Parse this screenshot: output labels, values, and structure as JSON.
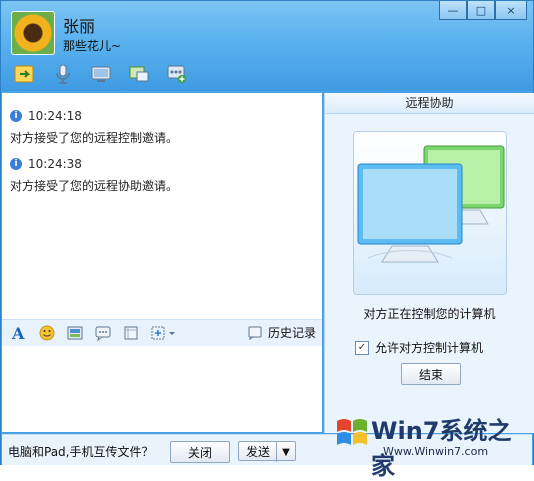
{
  "contact": {
    "name": "张丽",
    "signature": "那些花儿~"
  },
  "window_controls": {
    "minimize": "—",
    "maximize": "□",
    "close": "×"
  },
  "toolbar": [
    {
      "name": "transfer-file-icon"
    },
    {
      "name": "voice-call-icon"
    },
    {
      "name": "video-call-icon"
    },
    {
      "name": "remote-desktop-icon"
    },
    {
      "name": "more-apps-icon"
    }
  ],
  "chat": {
    "messages": [
      {
        "time": "10:24:18",
        "text": "对方接受了您的远程控制邀请。"
      },
      {
        "time": "10:24:38",
        "text": "对方接受了您的远程协助邀请。"
      }
    ]
  },
  "format_bar": {
    "history_label": "历史记录"
  },
  "remote_panel": {
    "title": "远程协助",
    "status": "对方正在控制您的计算机",
    "allow_label": "允许对方控制计算机",
    "allow_checked": true,
    "end_button": "结束"
  },
  "bottom": {
    "hint": "电脑和Pad,手机互传文件？",
    "close_button": "关闭",
    "send_button": "发送",
    "send_dropdown": "▼"
  },
  "watermark": {
    "brand": "Win7系统之家",
    "url": "Www.Winwin7.com"
  },
  "colors": {
    "titlebar": "#58b0ee",
    "accent": "#3f9be2",
    "panel": "#eaf4fd"
  }
}
